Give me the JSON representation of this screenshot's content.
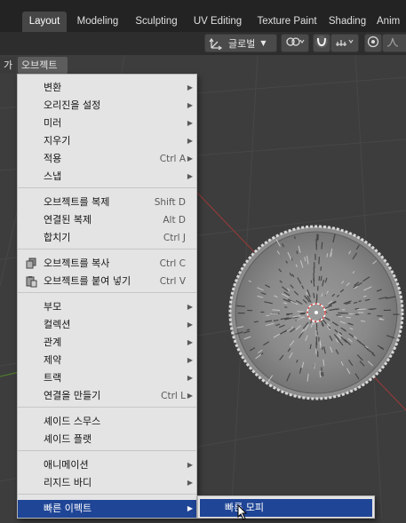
{
  "workspace_tabs": [
    {
      "label": "Layout",
      "active": true
    },
    {
      "label": "Modeling",
      "active": false
    },
    {
      "label": "Sculpting",
      "active": false
    },
    {
      "label": "UV Editing",
      "active": false
    },
    {
      "label": "Texture Paint",
      "active": false
    },
    {
      "label": "Shading",
      "active": false
    },
    {
      "label": "Anim",
      "active": false
    }
  ],
  "header": {
    "orientation_label": "글로벌",
    "orientation_icon": "transform-orientation-icon",
    "pivot_icon": "pivot-point-icon",
    "snap_icon": "snap-magnet-icon",
    "snap_target_icon": "snap-increment-icon",
    "proportional_icon": "proportional-edit-icon",
    "falloff_icon": "falloff-curve-icon"
  },
  "viewport_menu": {
    "add_label": "가",
    "object_label": "오브젝트"
  },
  "object_menu": {
    "items": [
      {
        "label": "변환",
        "shortcut": "",
        "submenu": true
      },
      {
        "label": "오리진을 설정",
        "shortcut": "",
        "submenu": true
      },
      {
        "label": "미러",
        "shortcut": "",
        "submenu": true
      },
      {
        "label": "지우기",
        "shortcut": "",
        "submenu": true
      },
      {
        "label": "적용",
        "shortcut": "Ctrl A",
        "submenu": true
      },
      {
        "label": "스냅",
        "shortcut": "",
        "submenu": true
      },
      {
        "label": "오브젝트를 복제",
        "shortcut": "Shift D",
        "submenu": false
      },
      {
        "label": "연결된 복제",
        "shortcut": "Alt D",
        "submenu": false
      },
      {
        "label": "합치기",
        "shortcut": "Ctrl J",
        "submenu": false
      },
      {
        "label": "오브젝트를 복사",
        "shortcut": "Ctrl C",
        "submenu": false,
        "icon": "copy-icon"
      },
      {
        "label": "오브젝트를 붙여 넣기",
        "shortcut": "Ctrl V",
        "submenu": false,
        "icon": "paste-icon"
      },
      {
        "label": "부모",
        "shortcut": "",
        "submenu": true
      },
      {
        "label": "컬렉션",
        "shortcut": "",
        "submenu": true
      },
      {
        "label": "관계",
        "shortcut": "",
        "submenu": true
      },
      {
        "label": "제약",
        "shortcut": "",
        "submenu": true
      },
      {
        "label": "트랙",
        "shortcut": "",
        "submenu": true
      },
      {
        "label": "연결을 만들기",
        "shortcut": "Ctrl L",
        "submenu": true
      },
      {
        "label": "셰이드 스무스",
        "shortcut": "",
        "submenu": false
      },
      {
        "label": "셰이드 플랫",
        "shortcut": "",
        "submenu": false
      },
      {
        "label": "애니메이션",
        "shortcut": "",
        "submenu": true
      },
      {
        "label": "리지드 바디",
        "shortcut": "",
        "submenu": true
      },
      {
        "label": "빠른 이펙트",
        "shortcut": "",
        "submenu": true,
        "active": true
      }
    ]
  },
  "submenu": {
    "items": [
      {
        "label": "빠른 모피",
        "active": true
      }
    ]
  },
  "colors": {
    "menu_highlight": "#1f4596",
    "menu_background": "#e4e4e4",
    "viewport_background": "#3d3d3d"
  }
}
